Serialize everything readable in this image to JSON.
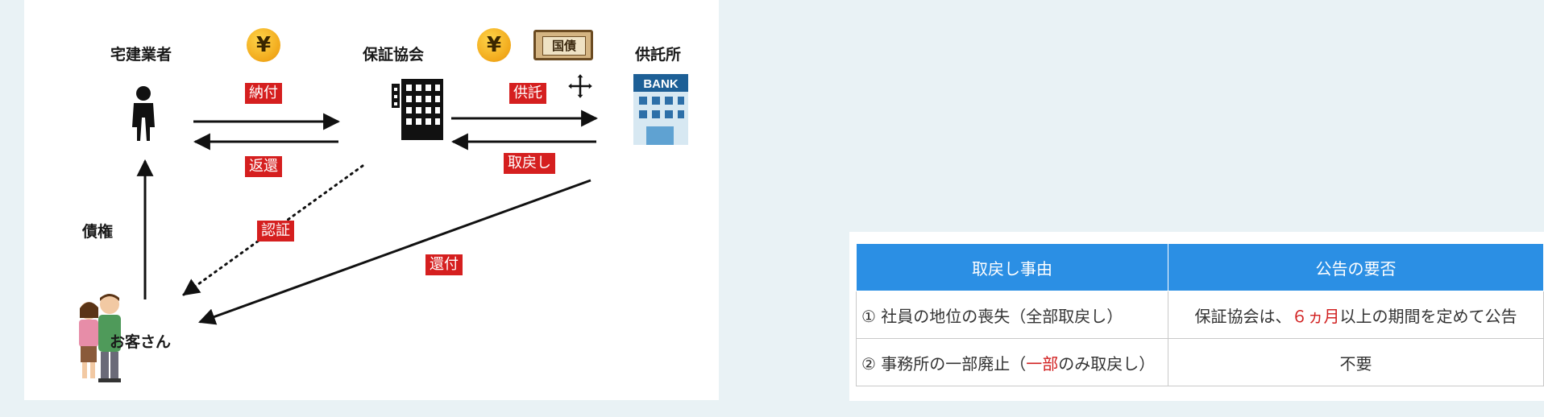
{
  "diagram": {
    "nodes": {
      "dealer": "宅建業者",
      "association": "保証協会",
      "depository": "供託所",
      "customer": "お客さん"
    },
    "tags": {
      "payment": "納付",
      "return": "返還",
      "deposit": "供託",
      "withdraw": "取戻し",
      "certify": "認証",
      "refund": "還付"
    },
    "claim_label": "債権",
    "coin_symbol": "¥",
    "bond_label": "国債",
    "bank_label": "BANK"
  },
  "table": {
    "headers": [
      "取戻し事由",
      "公告の要否"
    ],
    "rows": [
      {
        "reason_prefix": "① 社員の地位の喪失（全部取戻し）",
        "notice_before": "保証協会は、",
        "notice_highlight": "６ヵ月",
        "notice_after": "以上の期間を定めて公告"
      },
      {
        "reason_before": "② 事務所の一部廃止（",
        "reason_highlight": "一部",
        "reason_after": "のみ取戻し）",
        "notice": "不要"
      }
    ]
  },
  "colors": {
    "tag_red": "#d51f1f",
    "header_blue": "#2b8fe4",
    "highlight_red": "#d11f1f",
    "background": "#e9f2f5"
  }
}
